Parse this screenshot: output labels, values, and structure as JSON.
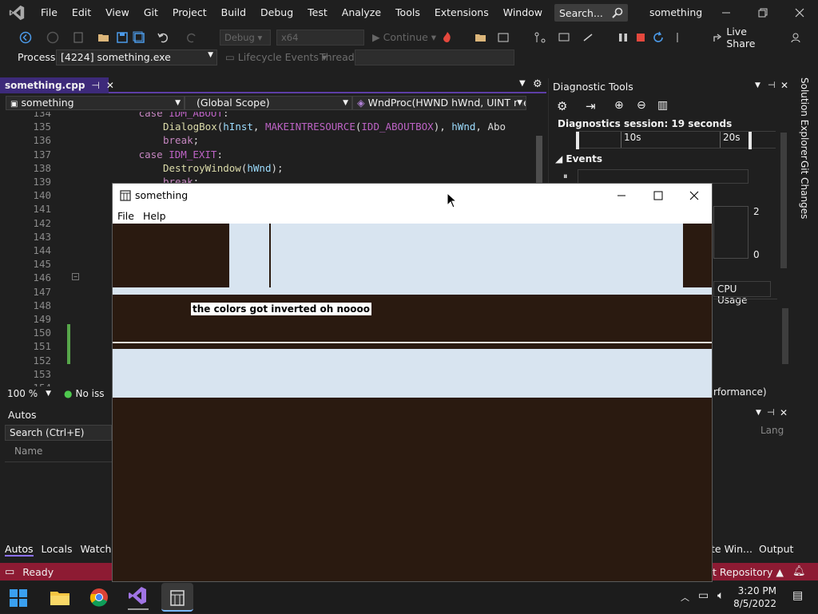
{
  "menubar": {
    "items": [
      "File",
      "Edit",
      "View",
      "Git",
      "Project",
      "Build",
      "Debug",
      "Test",
      "Analyze",
      "Tools",
      "Extensions",
      "Window",
      "Help"
    ],
    "search_label": "Search...",
    "solution_name": "something"
  },
  "toolbar": {
    "config_combo": "Debug",
    "platform_combo": "x64",
    "continue_label": "Continue",
    "live_share": "Live Share"
  },
  "debug_location": {
    "process_label": "Process:",
    "process_value": "[4224] something.exe",
    "lifecycle_label": "Lifecycle Events",
    "thread_label": "Thread:"
  },
  "editor": {
    "tab_title": "something.cpp",
    "nav_project": "something",
    "nav_scope": "(Global Scope)",
    "nav_function": "WndProc(HWND hWnd, UINT mes",
    "lines": [
      {
        "num": "134",
        "text": "case IDM_ABOUT:"
      },
      {
        "num": "135",
        "text": "DialogBox(hInst, MAKEINTRESOURCE(IDD_ABOUTBOX), hWnd, Abo"
      },
      {
        "num": "136",
        "text": "break;"
      },
      {
        "num": "137",
        "text": "case IDM_EXIT:"
      },
      {
        "num": "138",
        "text": "DestroyWindow(hWnd);"
      },
      {
        "num": "139",
        "text": "break;"
      },
      {
        "num": "140",
        "text": ""
      },
      {
        "num": "141",
        "text": ""
      },
      {
        "num": "142",
        "text": ""
      },
      {
        "num": "143",
        "text": ""
      },
      {
        "num": "144",
        "text": ""
      },
      {
        "num": "145",
        "text": ""
      },
      {
        "num": "146",
        "text": ""
      },
      {
        "num": "147",
        "text": ""
      },
      {
        "num": "148",
        "text": ""
      },
      {
        "num": "149",
        "text": ""
      },
      {
        "num": "150",
        "text": ""
      },
      {
        "num": "151",
        "text": ""
      },
      {
        "num": "152",
        "text": ""
      },
      {
        "num": "153",
        "text": ""
      },
      {
        "num": "154",
        "text": ""
      }
    ],
    "zoom": "100 %",
    "issues": "No iss"
  },
  "diagnostics": {
    "title": "Diagnostic Tools",
    "session": "Diagnostics session: 19 seconds",
    "tick_10s": "10s",
    "tick_20s": "20s",
    "events_label": "Events",
    "cpu_tab": "CPU Usage",
    "graph_max": "2",
    "graph_min": "0",
    "perf_partial": "rformance)"
  },
  "side_tabs": [
    "Solution Explorer",
    "Git Changes"
  ],
  "autos": {
    "title": "Autos",
    "search": "Search (Ctrl+E)",
    "col_name": "Name",
    "tabs": [
      "Autos",
      "Locals",
      "Watch"
    ]
  },
  "output_panel": {
    "lang_partial": "Lang",
    "tab_immediate": "te Win...",
    "tab_output": "Output"
  },
  "statusbar": {
    "ready": "Ready",
    "repo": "t Repository"
  },
  "taskbar": {
    "time": "3:20 PM",
    "date": "8/5/2022"
  },
  "app_window": {
    "title": "something",
    "menu": [
      "File",
      "Help"
    ],
    "message": "the colors got inverted oh noooo"
  }
}
